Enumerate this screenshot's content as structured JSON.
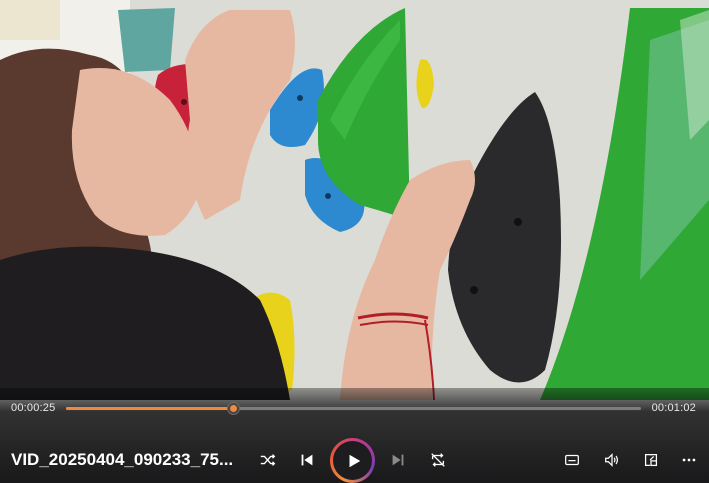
{
  "player": {
    "current_time": "00:00:25",
    "total_time": "00:01:02",
    "progress": 0.29,
    "file_title": "VID_20250404_090233_75...",
    "accent_color": "#f08a3a",
    "state": "paused"
  },
  "controls": {
    "left_group": [
      "shuffle-icon",
      "previous-icon",
      "play-icon",
      "next-icon",
      "repeat-off-icon"
    ],
    "right_group": [
      "captions-icon",
      "volume-icon",
      "mini-player-icon",
      "more-icon"
    ]
  },
  "video": {
    "scene": "climbing-wall-closeup",
    "colors": {
      "wall": "#d9d9d4",
      "green_volume": "#2fa836",
      "black_hold": "#2a2a2c",
      "blue_hold": "#2d8ad0",
      "red_hold": "#c8213a",
      "yellow_hold": "#e9d21c",
      "skin": "#e7b8a1",
      "hair": "#5a3a2e",
      "shirt": "#1f1d1f"
    }
  }
}
